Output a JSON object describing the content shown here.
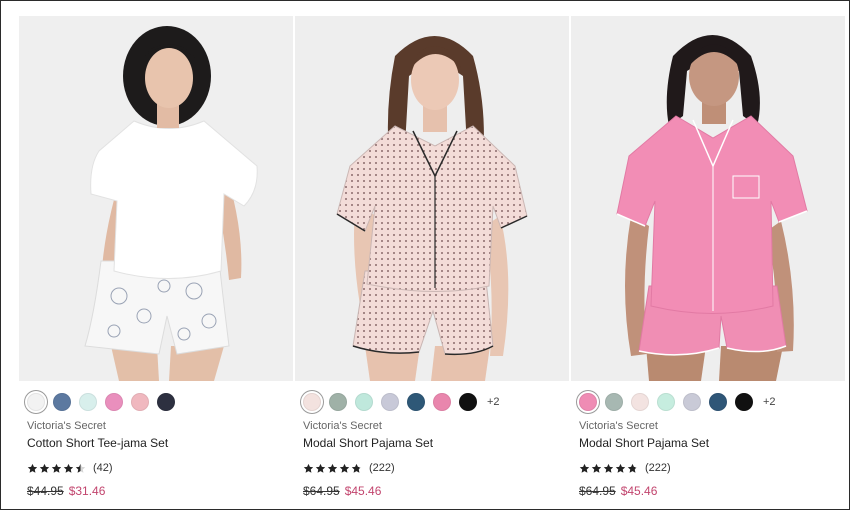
{
  "products": [
    {
      "brand": "Victoria's Secret",
      "name": "Cotton Short Tee-jama Set",
      "rating": 4.5,
      "review_count": "(42)",
      "original_price": "$44.95",
      "sale_price": "$31.46",
      "swatches": [
        "#f2f2f2",
        "#5c79a0",
        "#d8efec",
        "#e98fbd",
        "#f0b8bf",
        "#2d3040"
      ],
      "selected_swatch": 0,
      "more_colors": "",
      "outfit": "white tee, white floral print shorts"
    },
    {
      "brand": "Victoria's Secret",
      "name": "Modal Short Pajama Set",
      "rating": 4.8,
      "review_count": "(222)",
      "original_price": "$64.95",
      "sale_price": "$45.46",
      "swatches": [
        "#f3e2df",
        "#9fb1a7",
        "#bfe8dc",
        "#c8c9d8",
        "#2e5877",
        "#e986ad",
        "#111111"
      ],
      "selected_swatch": 0,
      "more_colors": "+2",
      "outfit": "light pink polka dot button shirt and shorts"
    },
    {
      "brand": "Victoria's Secret",
      "name": "Modal Short Pajama Set",
      "rating": 4.8,
      "review_count": "(222)",
      "original_price": "$64.95",
      "sale_price": "$45.46",
      "swatches": [
        "#ef8cb4",
        "#a7b8b2",
        "#f3e3e1",
        "#c6eddf",
        "#c9cad7",
        "#2f5677",
        "#111111"
      ],
      "selected_swatch": 0,
      "more_colors": "+2",
      "outfit": "pink button shirt and shorts"
    }
  ],
  "colors": {
    "sale_price": "#c2456e",
    "star": "#222222"
  }
}
